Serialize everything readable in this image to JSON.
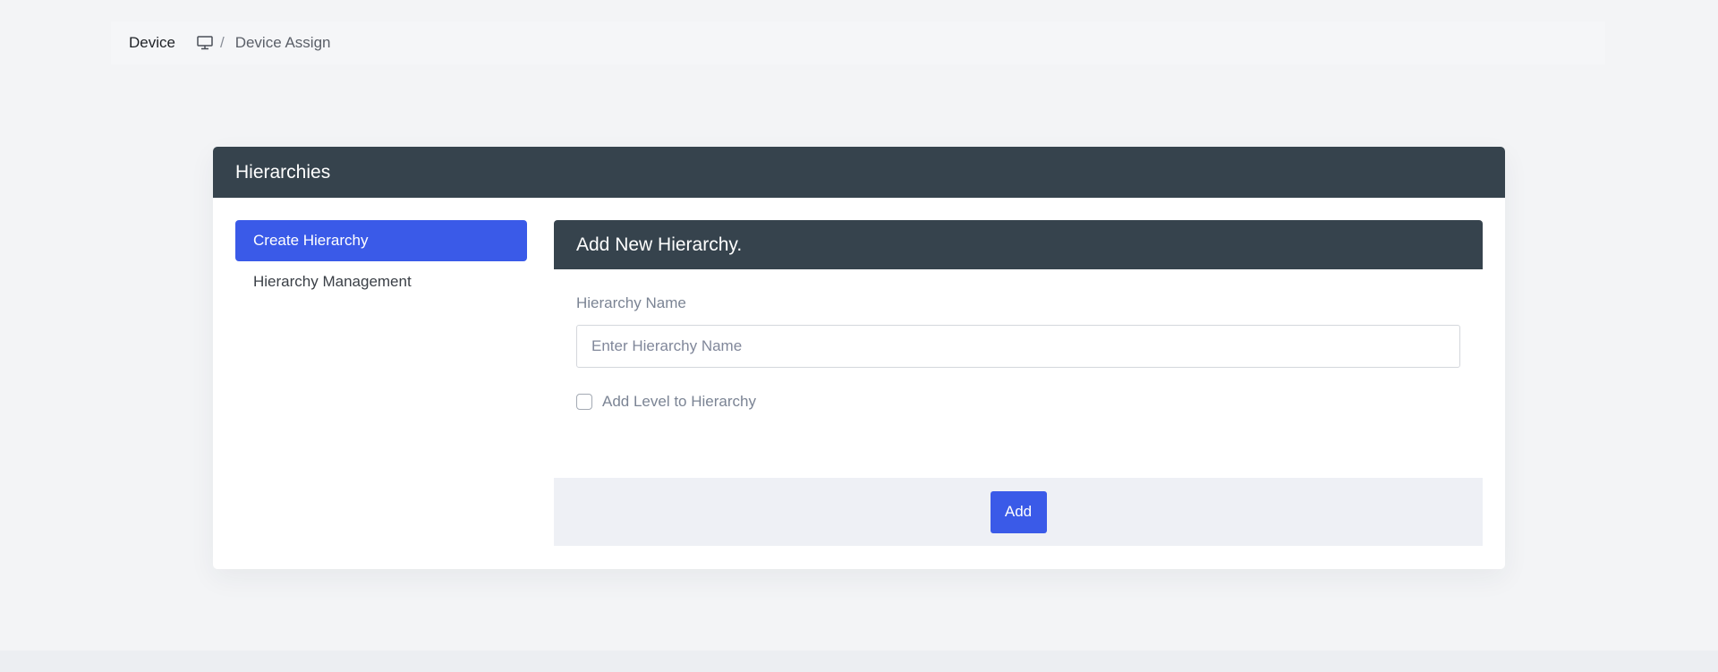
{
  "breadcrumb": {
    "title": "Device",
    "icon": "monitor-icon",
    "separator": "/",
    "current": "Device Assign"
  },
  "card": {
    "title": "Hierarchies"
  },
  "sidebar": {
    "items": [
      {
        "label": "Create Hierarchy",
        "active": true
      },
      {
        "label": "Hierarchy Management",
        "active": false
      }
    ]
  },
  "form": {
    "title": "Add New Hierarchy.",
    "name_label": "Hierarchy Name",
    "name_value": "",
    "name_placeholder": "Enter Hierarchy Name",
    "checkbox_label": "Add Level to Hierarchy",
    "checkbox_checked": false,
    "submit_label": "Add"
  },
  "colors": {
    "accent": "#3a5ae8",
    "header": "#36434d",
    "background": "#f3f4f6"
  }
}
